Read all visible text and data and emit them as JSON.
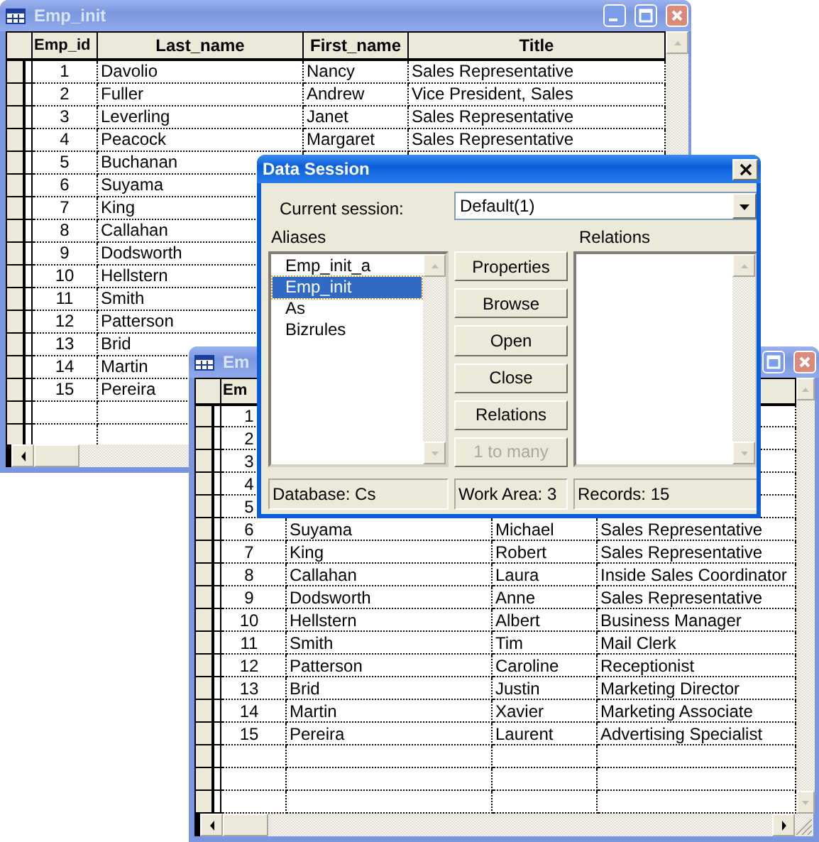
{
  "windows": [
    {
      "title": "Emp_init",
      "active": false,
      "columns": [
        {
          "label": "Emp_id"
        },
        {
          "label": "Last_name"
        },
        {
          "label": "First_name"
        },
        {
          "label": "Title"
        }
      ],
      "rows": [
        {
          "emp_id": "1",
          "last_name": "Davolio",
          "first_name": "Nancy",
          "title": "Sales Representative"
        },
        {
          "emp_id": "2",
          "last_name": "Fuller",
          "first_name": "Andrew",
          "title": "Vice President, Sales"
        },
        {
          "emp_id": "3",
          "last_name": "Leverling",
          "first_name": "Janet",
          "title": "Sales Representative"
        },
        {
          "emp_id": "4",
          "last_name": "Peacock",
          "first_name": "Margaret",
          "title": "Sales Representative"
        },
        {
          "emp_id": "5",
          "last_name": "Buchanan"
        },
        {
          "emp_id": "6",
          "last_name": "Suyama"
        },
        {
          "emp_id": "7",
          "last_name": "King"
        },
        {
          "emp_id": "8",
          "last_name": "Callahan"
        },
        {
          "emp_id": "9",
          "last_name": "Dodsworth"
        },
        {
          "emp_id": "10",
          "last_name": "Hellstern"
        },
        {
          "emp_id": "11",
          "last_name": "Smith"
        },
        {
          "emp_id": "12",
          "last_name": "Patterson"
        },
        {
          "emp_id": "13",
          "last_name": "Brid"
        },
        {
          "emp_id": "14",
          "last_name": "Martin"
        },
        {
          "emp_id": "15",
          "last_name": "Pereira"
        }
      ]
    },
    {
      "title": "Em",
      "active": false,
      "columns": [
        {
          "label": "Em"
        }
      ],
      "rows": [
        {
          "emp_id": "1"
        },
        {
          "emp_id": "2"
        },
        {
          "emp_id": "3"
        },
        {
          "emp_id": "4"
        },
        {
          "emp_id": "5"
        },
        {
          "emp_id": "6",
          "last_name": "Suyama",
          "first_name": "Michael",
          "title": "Sales Representative"
        },
        {
          "emp_id": "7",
          "last_name": "King",
          "first_name": "Robert",
          "title": "Sales Representative"
        },
        {
          "emp_id": "8",
          "last_name": "Callahan",
          "first_name": "Laura",
          "title": "Inside Sales Coordinator"
        },
        {
          "emp_id": "9",
          "last_name": "Dodsworth",
          "first_name": "Anne",
          "title": "Sales Representative"
        },
        {
          "emp_id": "10",
          "last_name": "Hellstern",
          "first_name": "Albert",
          "title": "Business Manager"
        },
        {
          "emp_id": "11",
          "last_name": "Smith",
          "first_name": "Tim",
          "title": "Mail Clerk"
        },
        {
          "emp_id": "12",
          "last_name": "Patterson",
          "first_name": "Caroline",
          "title": "Receptionist"
        },
        {
          "emp_id": "13",
          "last_name": "Brid",
          "first_name": "Justin",
          "title": "Marketing Director"
        },
        {
          "emp_id": "14",
          "last_name": "Martin",
          "first_name": "Xavier",
          "title": "Marketing Associate"
        },
        {
          "emp_id": "15",
          "last_name": "Pereira",
          "first_name": "Laurent",
          "title": "Advertising Specialist"
        }
      ]
    }
  ],
  "dialog": {
    "title": "Data Session",
    "active": true,
    "session_label": "Current session:",
    "session_value": "Default(1)",
    "aliases_label": "Aliases",
    "aliases": [
      {
        "label": "Emp_init_a",
        "selected": false
      },
      {
        "label": "Emp_init",
        "selected": true
      },
      {
        "label": "As",
        "selected": false
      },
      {
        "label": "Bizrules",
        "selected": false
      }
    ],
    "relations_label": "Relations",
    "buttons": [
      {
        "label": "Properties",
        "disabled": false
      },
      {
        "label": "Browse",
        "disabled": false
      },
      {
        "label": "Open",
        "disabled": false
      },
      {
        "label": "Close",
        "disabled": false
      },
      {
        "label": "Relations",
        "disabled": false
      },
      {
        "label": "1 to many",
        "disabled": true
      }
    ],
    "status": [
      "Database: Cs",
      "Work Area: 3",
      "Records: 15"
    ]
  }
}
